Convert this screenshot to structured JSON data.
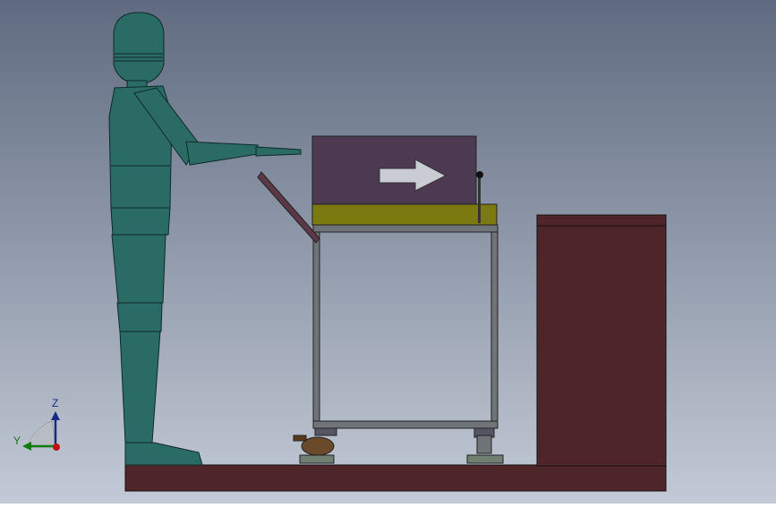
{
  "scene": {
    "background_top": "#5f6b80",
    "background_bottom": "#bfc6d2",
    "figure_color": "#2a6b66",
    "figure_outline": "#0e2a28",
    "platform_color": "#4e2629",
    "cart_frame_color": "#6f7478",
    "cart_top_color": "#7a7a10",
    "box_color": "#4b3a52",
    "arrow_color": "#c9ccd4"
  },
  "triad": {
    "z_label": "Z",
    "y_label": "Y",
    "z_color": "#1a2a80",
    "y_color": "#107a10",
    "origin_color": "#c01010"
  }
}
